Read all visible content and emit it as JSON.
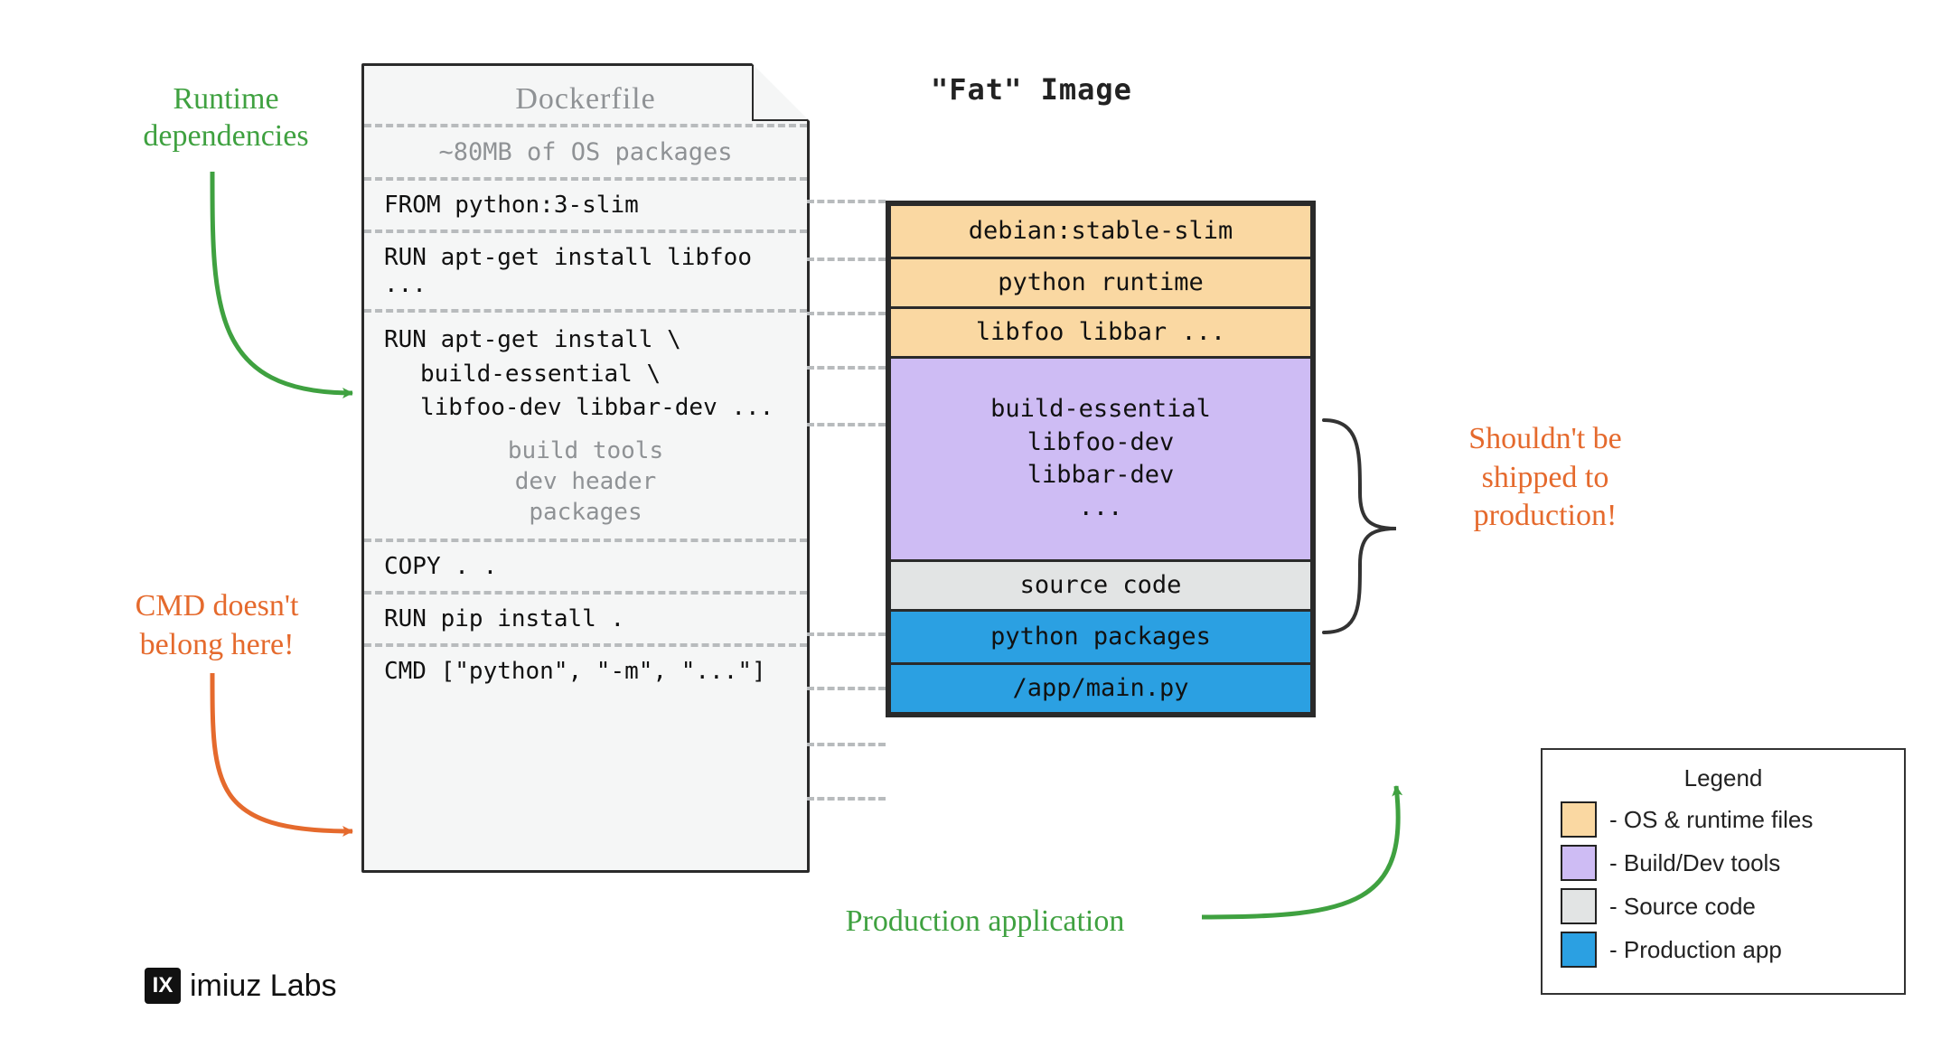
{
  "dockerfile": {
    "title": "Dockerfile",
    "os_note": "~80MB of OS packages",
    "lines": {
      "from": "FROM python:3-slim",
      "apt_libfoo": "RUN apt-get install libfoo ...",
      "apt_build_l1": "RUN apt-get install \\",
      "apt_build_l2": "build-essential \\",
      "apt_build_l3": "libfoo-dev libbar-dev ...",
      "build_comment_l1": "build tools",
      "build_comment_l2": "dev header",
      "build_comment_l3": "packages",
      "copy": "COPY . .",
      "pip": "RUN pip install .",
      "cmd": "CMD [\"python\", \"-m\", \"...\"]"
    }
  },
  "fat": {
    "title": "\"Fat\" Image",
    "layers": {
      "debian": "debian:stable-slim",
      "pyrt": "python runtime",
      "libfoo": "libfoo libbar ...",
      "build1": "build-essential",
      "build2": "libfoo-dev",
      "build3": "libbar-dev",
      "build4": "...",
      "source": "source code",
      "pypkgs": "python packages",
      "app": "/app/main.py"
    }
  },
  "annotations": {
    "runtime_deps_l1": "Runtime",
    "runtime_deps_l2": "dependencies",
    "cmd_warn_l1": "CMD doesn't",
    "cmd_warn_l2": "belong here!",
    "shouldnt_l1": "Shouldn't be",
    "shouldnt_l2": "shipped to",
    "shouldnt_l3": "production!",
    "prod_app": "Production application"
  },
  "legend": {
    "title": "Legend",
    "items": [
      {
        "color": "#fad8a2",
        "label": "- OS & runtime files"
      },
      {
        "color": "#cebcf4",
        "label": "- Build/Dev tools"
      },
      {
        "color": "#e2e4e4",
        "label": "- Source code"
      },
      {
        "color": "#2ba0e2",
        "label": "- Production app"
      }
    ]
  },
  "brand": "imiuz Labs"
}
